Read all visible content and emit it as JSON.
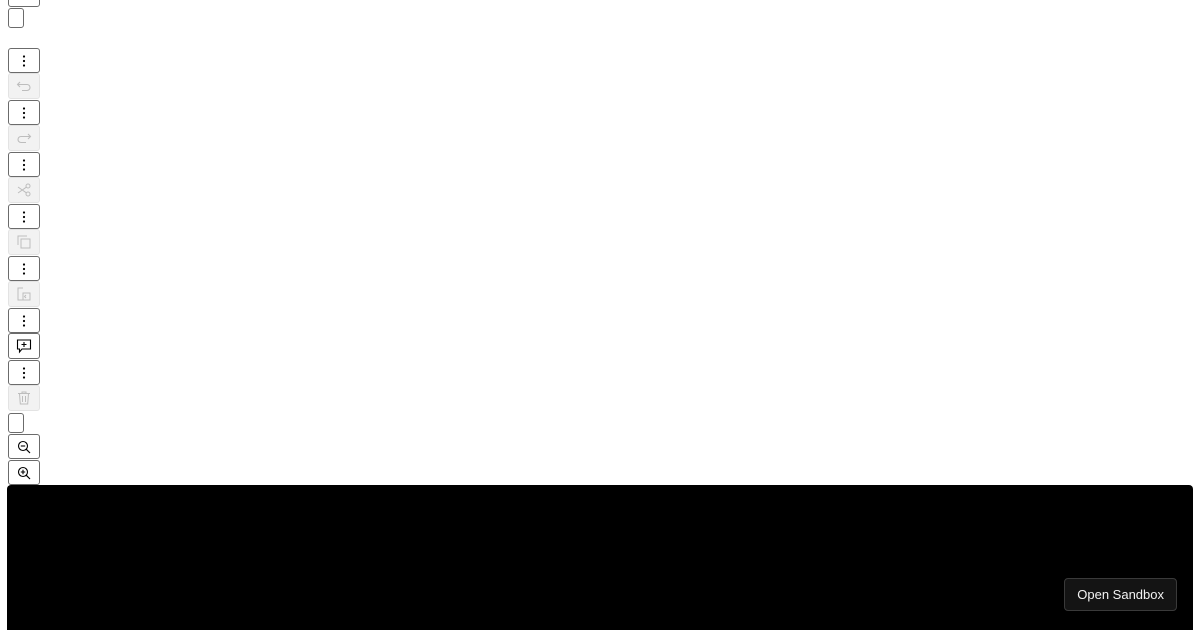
{
  "toolbar": {
    "buttons": [
      {
        "name": "kebab-menu-button",
        "icon": "kebab-icon",
        "enabled": true
      },
      {
        "name": "undo-button",
        "icon": "undo-icon",
        "enabled": false
      },
      {
        "name": "kebab-menu-button",
        "icon": "kebab-icon",
        "enabled": true
      },
      {
        "name": "redo-button",
        "icon": "redo-icon",
        "enabled": false
      },
      {
        "name": "kebab-menu-button",
        "icon": "kebab-icon",
        "enabled": true
      },
      {
        "name": "cut-button",
        "icon": "scissors-icon",
        "enabled": false
      },
      {
        "name": "kebab-menu-button",
        "icon": "kebab-icon",
        "enabled": true
      },
      {
        "name": "copy-button",
        "icon": "copy-icon",
        "enabled": false
      },
      {
        "name": "kebab-menu-button",
        "icon": "kebab-icon",
        "enabled": true
      },
      {
        "name": "paste-button",
        "icon": "paste-icon",
        "enabled": false
      },
      {
        "name": "kebab-menu-button",
        "icon": "kebab-icon",
        "enabled": true
      },
      {
        "name": "add-comment-button",
        "icon": "comment-plus-icon",
        "enabled": true
      },
      {
        "name": "kebab-menu-button",
        "icon": "kebab-icon",
        "enabled": true
      },
      {
        "name": "delete-button",
        "icon": "trash-icon",
        "enabled": false
      }
    ],
    "zoom_out_icon": "zoom-out-icon",
    "zoom_in_icon": "zoom-in-icon"
  },
  "sandbox": {
    "open_label": "Open Sandbox"
  }
}
